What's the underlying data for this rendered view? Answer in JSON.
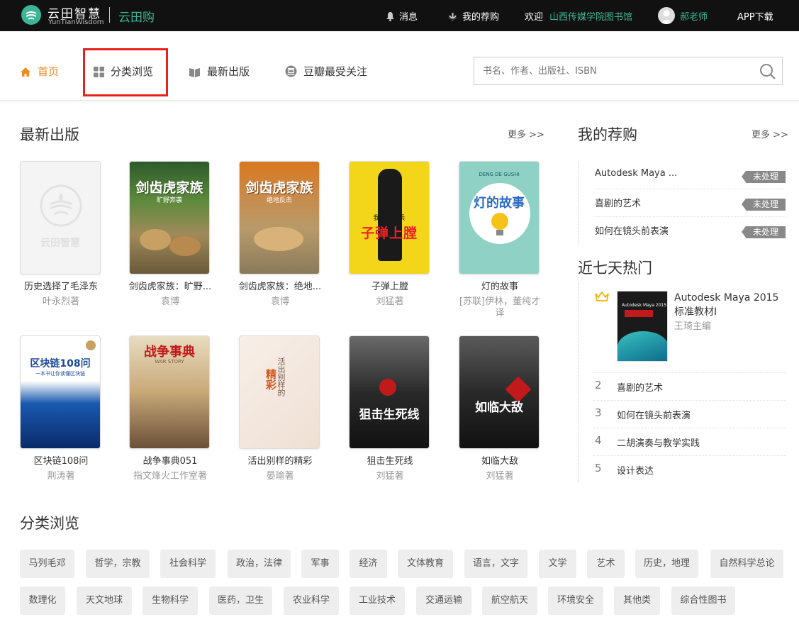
{
  "header": {
    "logo_cn": "云田智慧",
    "logo_en": "YunTianWisdom",
    "app_name": "云田购",
    "messages": "消息",
    "my_recommend": "我的荐购",
    "welcome": "欢迎",
    "library": "山西传媒学院图书馆",
    "user": "郝老师",
    "app_download": "APP下载"
  },
  "nav": {
    "home": "首页",
    "category": "分类浏览",
    "latest": "最新出版",
    "douban": "豆瓣最受关注",
    "search_placeholder": "书名、作者、出版社、ISBN"
  },
  "latest": {
    "title": "最新出版",
    "more": "更多 >>",
    "books": [
      {
        "title": "历史选择了毛泽东",
        "author": "叶永烈著",
        "cover_text": "云田智慧"
      },
      {
        "title": "剑齿虎家族：旷野...",
        "author": "袁博",
        "cover_text": "剑齿虎家族",
        "cover_sub": "旷野奔袭"
      },
      {
        "title": "剑齿虎家族：绝地...",
        "author": "袁博",
        "cover_text": "剑齿虎家族",
        "cover_sub": "绝地反击"
      },
      {
        "title": "子弹上膛",
        "author": "刘猛著",
        "cover_text": "子弹上膛",
        "cover_sub": "我是特种兵"
      },
      {
        "title": "灯的故事",
        "author": "[苏联]伊林，董纯才译",
        "cover_text": "灯的故事",
        "cover_sub": "DENG DE GUSHI"
      },
      {
        "title": "区块链108问",
        "author": "荆涛著",
        "cover_text": "区块链108问",
        "cover_sub": "一本书让你读懂区块链"
      },
      {
        "title": "战争事典051",
        "author": "指文烽火工作室著",
        "cover_text": "战争事典",
        "cover_sub": "WAR STORY"
      },
      {
        "title": "活出别样的精彩",
        "author": "晏瑜著",
        "cover_text": "精彩",
        "cover_sub": "活出别样的"
      },
      {
        "title": "狙击生死线",
        "author": "刘猛著",
        "cover_text": "狙击生死线"
      },
      {
        "title": "如临大敌",
        "author": "刘猛著",
        "cover_text": "如临大敌"
      }
    ]
  },
  "recommend": {
    "title": "我的荐购",
    "more": "更多 >>",
    "items": [
      {
        "title": "Autodesk Maya ...",
        "status": "未处理"
      },
      {
        "title": "喜剧的艺术",
        "status": "未处理"
      },
      {
        "title": "如何在镜头前表演",
        "status": "未处理"
      }
    ]
  },
  "hot": {
    "title": "近七天热门",
    "top": {
      "title": "Autodesk Maya 2015标准教材I",
      "author": "王琦主编",
      "cover_text": "Autodesk Maya 2015"
    },
    "items": [
      {
        "rank": "2",
        "title": "喜剧的艺术"
      },
      {
        "rank": "3",
        "title": "如何在镜头前表演"
      },
      {
        "rank": "4",
        "title": "二胡演奏与教学实践"
      },
      {
        "rank": "5",
        "title": "设计表达"
      }
    ]
  },
  "categories": {
    "title": "分类浏览",
    "items": [
      "马列毛邓",
      "哲学，宗教",
      "社会科学",
      "政治，法律",
      "军事",
      "经济",
      "文体教育",
      "语言，文字",
      "文学",
      "艺术",
      "历史，地理",
      "自然科学总论",
      "数理化",
      "天文地球",
      "生物科学",
      "医药，卫生",
      "农业科学",
      "工业技术",
      "交通运输",
      "航空航天",
      "环境安全",
      "其他类",
      "综合性图书"
    ]
  }
}
